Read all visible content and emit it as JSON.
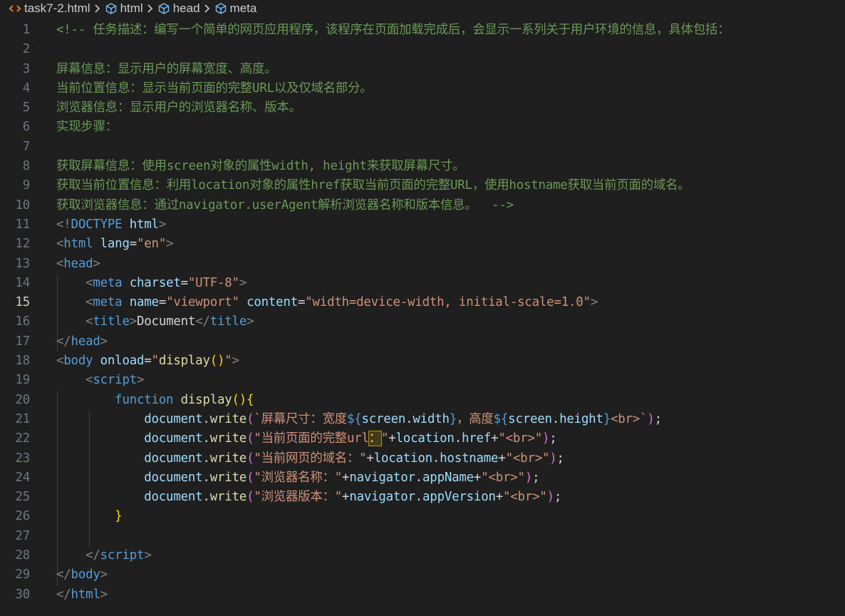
{
  "breadcrumb": {
    "file": "task7-2.html",
    "items": [
      "html",
      "head",
      "meta"
    ]
  },
  "editor": {
    "active_line": 15,
    "lines": [
      {
        "n": 1,
        "tokens": [
          {
            "t": "<!-- 任务描述：编写一个简单的网页应用程序，该程序在页面加载完成后，会显示一系列关于用户环境的信息，具体包括：",
            "c": "comment"
          }
        ]
      },
      {
        "n": 2,
        "tokens": []
      },
      {
        "n": 3,
        "tokens": [
          {
            "t": "屏幕信息：显示用户的屏幕宽度、高度。",
            "c": "comment"
          }
        ]
      },
      {
        "n": 4,
        "tokens": [
          {
            "t": "当前位置信息：显示当前页面的完整URL以及仅域名部分。",
            "c": "comment"
          }
        ]
      },
      {
        "n": 5,
        "tokens": [
          {
            "t": "浏览器信息：显示用户的浏览器名称、版本。",
            "c": "comment"
          }
        ]
      },
      {
        "n": 6,
        "tokens": [
          {
            "t": "实现步骤：",
            "c": "comment"
          }
        ]
      },
      {
        "n": 7,
        "tokens": []
      },
      {
        "n": 8,
        "tokens": [
          {
            "t": "获取屏幕信息：使用screen对象的属性width, height来获取屏幕尺寸。",
            "c": "comment"
          }
        ]
      },
      {
        "n": 9,
        "tokens": [
          {
            "t": "获取当前位置信息：利用location对象的属性href获取当前页面的完整URL，使用hostname获取当前页面的域名。",
            "c": "comment"
          }
        ]
      },
      {
        "n": 10,
        "tokens": [
          {
            "t": "获取浏览器信息：通过navigator.userAgent解析浏览器名称和版本信息。  -->",
            "c": "comment"
          }
        ]
      },
      {
        "n": 11,
        "tokens": [
          {
            "t": "<!",
            "c": "punct"
          },
          {
            "t": "DOCTYPE ",
            "c": "tag"
          },
          {
            "t": "html",
            "c": "attr"
          },
          {
            "t": ">",
            "c": "punct"
          }
        ]
      },
      {
        "n": 12,
        "tokens": [
          {
            "t": "<",
            "c": "punct"
          },
          {
            "t": "html ",
            "c": "tag"
          },
          {
            "t": "lang",
            "c": "attr"
          },
          {
            "t": "=",
            "c": "text"
          },
          {
            "t": "\"en\"",
            "c": "str"
          },
          {
            "t": ">",
            "c": "punct"
          }
        ]
      },
      {
        "n": 13,
        "tokens": [
          {
            "t": "<",
            "c": "punct"
          },
          {
            "t": "head",
            "c": "tag"
          },
          {
            "t": ">",
            "c": "punct"
          }
        ]
      },
      {
        "n": 14,
        "tokens": [
          {
            "t": "    ",
            "c": "text"
          },
          {
            "t": "<",
            "c": "punct"
          },
          {
            "t": "meta ",
            "c": "tag"
          },
          {
            "t": "charset",
            "c": "attr"
          },
          {
            "t": "=",
            "c": "text"
          },
          {
            "t": "\"UTF-8\"",
            "c": "str"
          },
          {
            "t": ">",
            "c": "punct"
          }
        ]
      },
      {
        "n": 15,
        "tokens": [
          {
            "t": "    ",
            "c": "text"
          },
          {
            "t": "<",
            "c": "punct"
          },
          {
            "t": "meta ",
            "c": "tag"
          },
          {
            "t": "name",
            "c": "attr"
          },
          {
            "t": "=",
            "c": "text"
          },
          {
            "t": "\"viewport\" ",
            "c": "str"
          },
          {
            "t": "content",
            "c": "attr"
          },
          {
            "t": "=",
            "c": "text"
          },
          {
            "t": "\"width=device-width, initial-scale=1.0\"",
            "c": "str"
          },
          {
            "t": ">",
            "c": "punct"
          }
        ]
      },
      {
        "n": 16,
        "tokens": [
          {
            "t": "    ",
            "c": "text"
          },
          {
            "t": "<",
            "c": "punct"
          },
          {
            "t": "title",
            "c": "tag"
          },
          {
            "t": ">",
            "c": "punct"
          },
          {
            "t": "Document",
            "c": "text"
          },
          {
            "t": "</",
            "c": "punct"
          },
          {
            "t": "title",
            "c": "tag"
          },
          {
            "t": ">",
            "c": "punct"
          }
        ]
      },
      {
        "n": 17,
        "tokens": [
          {
            "t": "</",
            "c": "punct"
          },
          {
            "t": "head",
            "c": "tag"
          },
          {
            "t": ">",
            "c": "punct"
          }
        ]
      },
      {
        "n": 18,
        "tokens": [
          {
            "t": "<",
            "c": "punct"
          },
          {
            "t": "body ",
            "c": "tag"
          },
          {
            "t": "onload",
            "c": "attr"
          },
          {
            "t": "=",
            "c": "text"
          },
          {
            "t": "\"",
            "c": "str"
          },
          {
            "t": "display",
            "c": "fn"
          },
          {
            "t": "()",
            "c": "br1"
          },
          {
            "t": "\"",
            "c": "str"
          },
          {
            "t": ">",
            "c": "punct"
          }
        ]
      },
      {
        "n": 19,
        "tokens": [
          {
            "t": "    ",
            "c": "text"
          },
          {
            "t": "<",
            "c": "punct"
          },
          {
            "t": "script",
            "c": "tag"
          },
          {
            "t": ">",
            "c": "punct"
          }
        ]
      },
      {
        "n": 20,
        "tokens": [
          {
            "t": "        ",
            "c": "text"
          },
          {
            "t": "function ",
            "c": "kw"
          },
          {
            "t": "display",
            "c": "fn"
          },
          {
            "t": "(){",
            "c": "br1"
          }
        ]
      },
      {
        "n": 21,
        "tokens": [
          {
            "t": "            ",
            "c": "text"
          },
          {
            "t": "document",
            "c": "var"
          },
          {
            "t": ".",
            "c": "text"
          },
          {
            "t": "write",
            "c": "fn"
          },
          {
            "t": "(",
            "c": "br2"
          },
          {
            "t": "`屏幕尺寸：宽度",
            "c": "str"
          },
          {
            "t": "${",
            "c": "kw"
          },
          {
            "t": "screen",
            "c": "var"
          },
          {
            "t": ".",
            "c": "text"
          },
          {
            "t": "width",
            "c": "var"
          },
          {
            "t": "}",
            "c": "kw"
          },
          {
            "t": "，高度",
            "c": "str"
          },
          {
            "t": "${",
            "c": "kw"
          },
          {
            "t": "screen",
            "c": "var"
          },
          {
            "t": ".",
            "c": "text"
          },
          {
            "t": "height",
            "c": "var"
          },
          {
            "t": "}",
            "c": "kw"
          },
          {
            "t": "<br>`",
            "c": "str"
          },
          {
            "t": ")",
            "c": "br2"
          },
          {
            "t": ";",
            "c": "text"
          }
        ]
      },
      {
        "n": 22,
        "tokens": [
          {
            "t": "            ",
            "c": "text"
          },
          {
            "t": "document",
            "c": "var"
          },
          {
            "t": ".",
            "c": "text"
          },
          {
            "t": "write",
            "c": "fn"
          },
          {
            "t": "(",
            "c": "br2"
          },
          {
            "t": "\"当前页面的完整url",
            "c": "str"
          },
          {
            "t": "：",
            "c": "cursor"
          },
          {
            "t": "\"",
            "c": "str"
          },
          {
            "t": "+",
            "c": "text"
          },
          {
            "t": "location",
            "c": "var"
          },
          {
            "t": ".",
            "c": "text"
          },
          {
            "t": "href",
            "c": "var"
          },
          {
            "t": "+",
            "c": "text"
          },
          {
            "t": "\"<br>\"",
            "c": "str"
          },
          {
            "t": ")",
            "c": "br2"
          },
          {
            "t": ";",
            "c": "text"
          }
        ]
      },
      {
        "n": 23,
        "tokens": [
          {
            "t": "            ",
            "c": "text"
          },
          {
            "t": "document",
            "c": "var"
          },
          {
            "t": ".",
            "c": "text"
          },
          {
            "t": "write",
            "c": "fn"
          },
          {
            "t": "(",
            "c": "br2"
          },
          {
            "t": "\"当前网页的域名：\"",
            "c": "str"
          },
          {
            "t": "+",
            "c": "text"
          },
          {
            "t": "location",
            "c": "var"
          },
          {
            "t": ".",
            "c": "text"
          },
          {
            "t": "hostname",
            "c": "var"
          },
          {
            "t": "+",
            "c": "text"
          },
          {
            "t": "\"<br>\"",
            "c": "str"
          },
          {
            "t": ")",
            "c": "br2"
          },
          {
            "t": ";",
            "c": "text"
          }
        ]
      },
      {
        "n": 24,
        "tokens": [
          {
            "t": "            ",
            "c": "text"
          },
          {
            "t": "document",
            "c": "var"
          },
          {
            "t": ".",
            "c": "text"
          },
          {
            "t": "write",
            "c": "fn"
          },
          {
            "t": "(",
            "c": "br2"
          },
          {
            "t": "\"浏览器名称：\"",
            "c": "str"
          },
          {
            "t": "+",
            "c": "text"
          },
          {
            "t": "navigator",
            "c": "var"
          },
          {
            "t": ".",
            "c": "text"
          },
          {
            "t": "appName",
            "c": "var"
          },
          {
            "t": "+",
            "c": "text"
          },
          {
            "t": "\"<br>\"",
            "c": "str"
          },
          {
            "t": ")",
            "c": "br2"
          },
          {
            "t": ";",
            "c": "text"
          }
        ]
      },
      {
        "n": 25,
        "tokens": [
          {
            "t": "            ",
            "c": "text"
          },
          {
            "t": "document",
            "c": "var"
          },
          {
            "t": ".",
            "c": "text"
          },
          {
            "t": "write",
            "c": "fn"
          },
          {
            "t": "(",
            "c": "br2"
          },
          {
            "t": "\"浏览器版本：\"",
            "c": "str"
          },
          {
            "t": "+",
            "c": "text"
          },
          {
            "t": "navigator",
            "c": "var"
          },
          {
            "t": ".",
            "c": "text"
          },
          {
            "t": "appVersion",
            "c": "var"
          },
          {
            "t": "+",
            "c": "text"
          },
          {
            "t": "\"<br>\"",
            "c": "str"
          },
          {
            "t": ")",
            "c": "br2"
          },
          {
            "t": ";",
            "c": "text"
          }
        ]
      },
      {
        "n": 26,
        "tokens": [
          {
            "t": "        ",
            "c": "text"
          },
          {
            "t": "}",
            "c": "br1"
          }
        ]
      },
      {
        "n": 27,
        "tokens": []
      },
      {
        "n": 28,
        "tokens": [
          {
            "t": "    ",
            "c": "text"
          },
          {
            "t": "</",
            "c": "punct"
          },
          {
            "t": "script",
            "c": "tag"
          },
          {
            "t": ">",
            "c": "punct"
          }
        ]
      },
      {
        "n": 29,
        "tokens": [
          {
            "t": "</",
            "c": "punct"
          },
          {
            "t": "body",
            "c": "tag"
          },
          {
            "t": ">",
            "c": "punct"
          }
        ]
      },
      {
        "n": 30,
        "tokens": [
          {
            "t": "</",
            "c": "punct"
          },
          {
            "t": "html",
            "c": "tag"
          },
          {
            "t": ">",
            "c": "punct"
          }
        ]
      }
    ]
  },
  "colors": {
    "background": "#1f1f1f",
    "comment": "#6a9955",
    "tag": "#569cd6",
    "attribute": "#9cdcfe",
    "string": "#ce9178",
    "function": "#dcdcaa",
    "bracket": "#ffd700"
  }
}
